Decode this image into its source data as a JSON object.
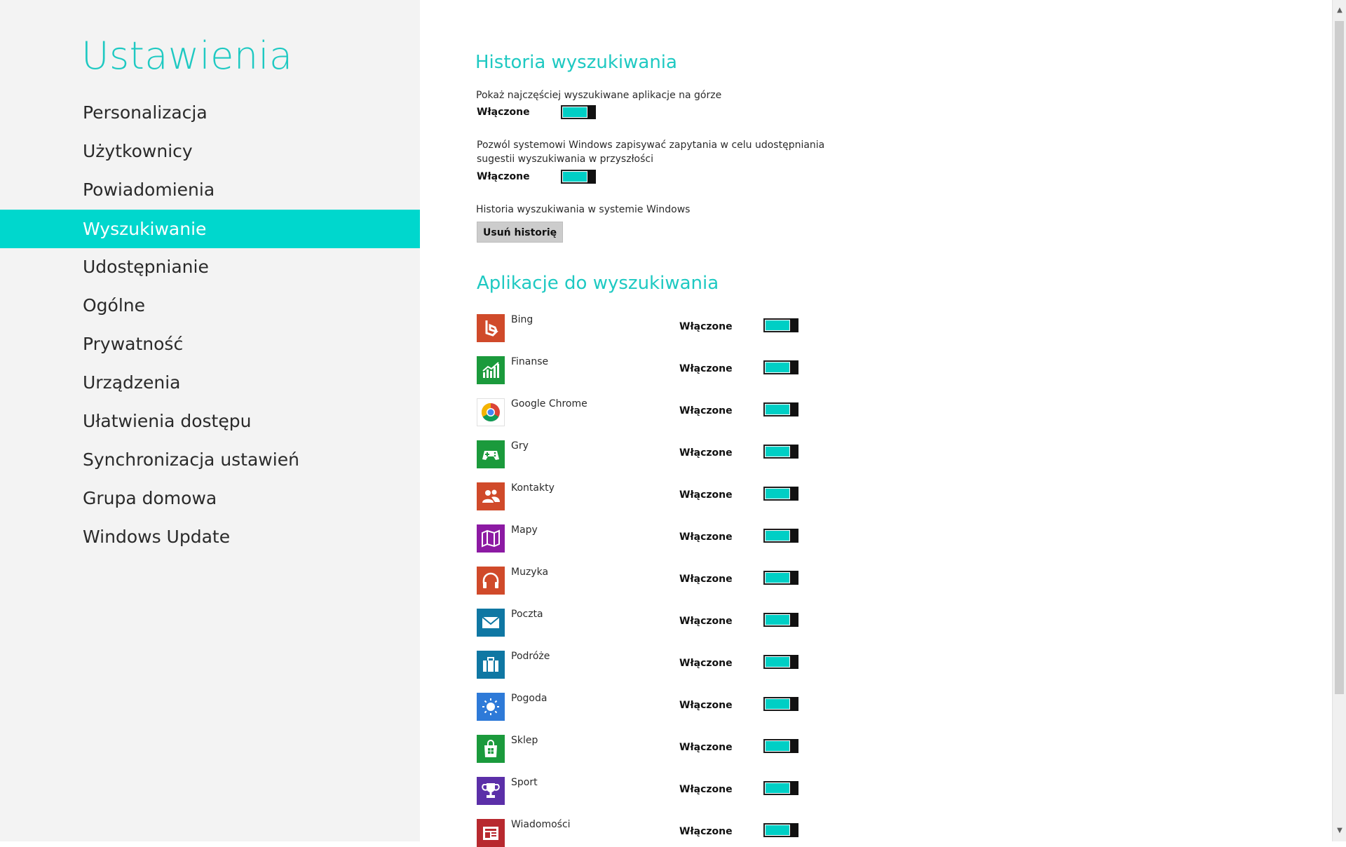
{
  "sidebar": {
    "title": "Ustawienia",
    "items": [
      {
        "label": "Personalizacja"
      },
      {
        "label": "Użytkownicy"
      },
      {
        "label": "Powiadomienia"
      },
      {
        "label": "Wyszukiwanie",
        "active": true
      },
      {
        "label": "Udostępnianie"
      },
      {
        "label": "Ogólne"
      },
      {
        "label": "Prywatność"
      },
      {
        "label": "Urządzenia"
      },
      {
        "label": "Ułatwienia dostępu"
      },
      {
        "label": "Synchronizacja ustawień"
      },
      {
        "label": "Grupa domowa"
      },
      {
        "label": "Windows Update"
      }
    ]
  },
  "history": {
    "title": "Historia wyszukiwania",
    "setting1": {
      "desc": "Pokaż najczęściej wyszukiwane aplikacje na górze",
      "state": "Włączone"
    },
    "setting2": {
      "desc": "Pozwól systemowi Windows zapisywać zapytania w celu udostępniania sugestii wyszukiwania w przyszłości",
      "state": "Włączone"
    },
    "setting3": {
      "desc": "Historia wyszukiwania w systemie Windows",
      "button": "Usuń historię"
    }
  },
  "apps": {
    "title": "Aplikacje do wyszukiwania",
    "items": [
      {
        "name": "Bing",
        "state": "Włączone",
        "icon": "bing-icon",
        "color": "#d04a2a"
      },
      {
        "name": "Finanse",
        "state": "Włączone",
        "icon": "finance-icon",
        "color": "#1b9a3c"
      },
      {
        "name": "Google Chrome",
        "state": "Włączone",
        "icon": "chrome-icon",
        "color": "#ffffff"
      },
      {
        "name": "Gry",
        "state": "Włączone",
        "icon": "games-icon",
        "color": "#1b9a3c"
      },
      {
        "name": "Kontakty",
        "state": "Włączone",
        "icon": "people-icon",
        "color": "#d04a2a"
      },
      {
        "name": "Mapy",
        "state": "Włączone",
        "icon": "maps-icon",
        "color": "#8c1aa3"
      },
      {
        "name": "Muzyka",
        "state": "Włączone",
        "icon": "music-icon",
        "color": "#d04a2a"
      },
      {
        "name": "Poczta",
        "state": "Włączone",
        "icon": "mail-icon",
        "color": "#0f77a3"
      },
      {
        "name": "Podróże",
        "state": "Włączone",
        "icon": "travel-icon",
        "color": "#0f77a3"
      },
      {
        "name": "Pogoda",
        "state": "Włączone",
        "icon": "weather-icon",
        "color": "#2e7ad8"
      },
      {
        "name": "Sklep",
        "state": "Włączone",
        "icon": "store-icon",
        "color": "#1b9a3c"
      },
      {
        "name": "Sport",
        "state": "Włączone",
        "icon": "sport-icon",
        "color": "#5b2fa8"
      },
      {
        "name": "Wiadomości",
        "state": "Włączone",
        "icon": "news-icon",
        "color": "#b8292f"
      }
    ]
  },
  "colors": {
    "accent": "#00d7cd",
    "toggle_fill": "#00cfc5"
  }
}
